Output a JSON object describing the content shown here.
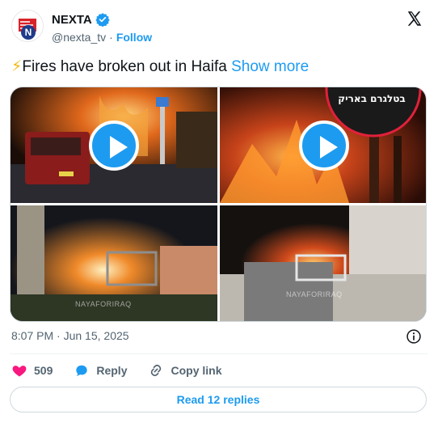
{
  "author": {
    "name": "NEXTA",
    "handle": "@nexta_tv",
    "separator": "·",
    "follow_label": "Follow",
    "avatar_letter": "N"
  },
  "tweet": {
    "emoji": "⚡",
    "text": "Fires have broken out in Haifa",
    "show_more_label": "Show more"
  },
  "media": {
    "tiles": [
      {
        "kind": "video",
        "icon": "play-icon"
      },
      {
        "kind": "video",
        "icon": "play-icon",
        "overlay_text": "בטלגרם באריק"
      },
      {
        "kind": "image",
        "watermark": "NAYAFORIRAQ"
      },
      {
        "kind": "image",
        "watermark": "NAYAFORIRAQ"
      }
    ]
  },
  "meta": {
    "time": "8:07 PM",
    "separator": "·",
    "date": "Jun 15, 2025"
  },
  "actions": {
    "likes": "509",
    "reply_label": "Reply",
    "copy_link_label": "Copy link"
  },
  "replies": {
    "label": "Read 12 replies"
  },
  "colors": {
    "accent": "#1d9bf0",
    "like": "#f91880",
    "text": "#0f1419",
    "muted": "#536471",
    "brand_red": "#d8232a"
  }
}
